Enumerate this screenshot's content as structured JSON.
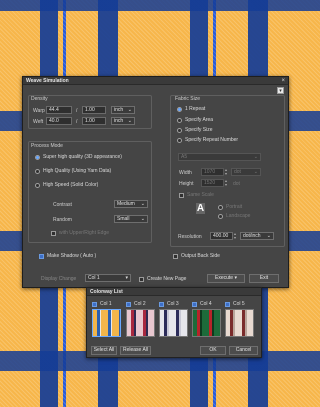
{
  "dialog": {
    "title": "Weave Simulation",
    "close": "×",
    "help": "▾",
    "density": {
      "label": "Density",
      "warp_label": "Warp",
      "warp_value": "44.4",
      "warp_div": "1.00",
      "weft_label": "Weft",
      "weft_value": "40.0",
      "weft_div": "1.00",
      "slash": "/",
      "unit": "inch"
    },
    "fabric_size": {
      "label": "Fabric Size",
      "options": [
        "1 Repeat",
        "Specify Area",
        "Specify Size",
        "Specify Repeat Number"
      ],
      "paper": "A5",
      "width_label": "Width",
      "width_value": "1070",
      "height_label": "Height",
      "height_value": "1520",
      "dot": "dot",
      "same_scale": "Same Scale",
      "orient_icon": "A",
      "portrait": "Portrait",
      "landscape": "Landscape",
      "resolution_label": "Resolution",
      "resolution_value": "400.00",
      "resolution_unit": "dot/inch"
    },
    "process_mode": {
      "label": "Process Mode",
      "options": [
        "Super high quality (3D appearance)",
        "High Quality (Using Yarn Data)",
        "High Speed (Solid Color)"
      ],
      "contrast_label": "Contrast",
      "contrast_value": "Medium",
      "random_label": "Random",
      "random_value": "Small",
      "upper_right_edge": "with Upper/Right Edge"
    },
    "make_shadow": "Make Shadow ( Auto )",
    "output_back_side": "Output Back Side",
    "display_change_label": "Display Change",
    "display_change_value": "Col 1",
    "create_new_page": "Create New Page",
    "execute": "Execute",
    "exit": "Exit"
  },
  "colorway_list": {
    "title": "Colorway List",
    "items": [
      "Col 1",
      "Col 2",
      "Col 3",
      "Col 4",
      "Col 5"
    ],
    "select_all": "Select All",
    "release_all": "Release All",
    "ok": "OK",
    "cancel": "Cancel"
  },
  "colors": {
    "background_gold": "#f7b64a",
    "tartan_blue": "#143c96",
    "accent_blue": "#3d6fc8"
  }
}
